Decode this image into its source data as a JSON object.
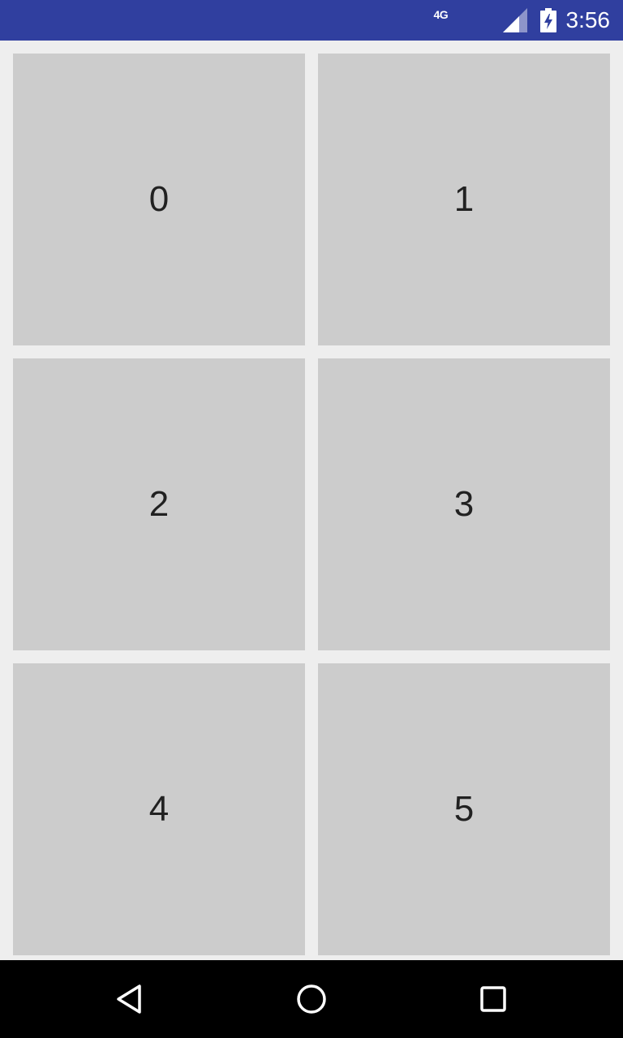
{
  "status_bar": {
    "network": "4G",
    "time": "3:56",
    "icons": [
      "signal-icon",
      "battery-charging-icon"
    ],
    "background_color": "#303f9f"
  },
  "grid": {
    "tiles": [
      {
        "label": "0"
      },
      {
        "label": "1"
      },
      {
        "label": "2"
      },
      {
        "label": "3"
      },
      {
        "label": "4"
      },
      {
        "label": "5"
      }
    ],
    "tile_color": "#cccccc",
    "background_color": "#eeeeee"
  },
  "nav_bar": {
    "buttons": [
      "back-icon",
      "home-icon",
      "recents-icon"
    ],
    "background_color": "#000000"
  }
}
